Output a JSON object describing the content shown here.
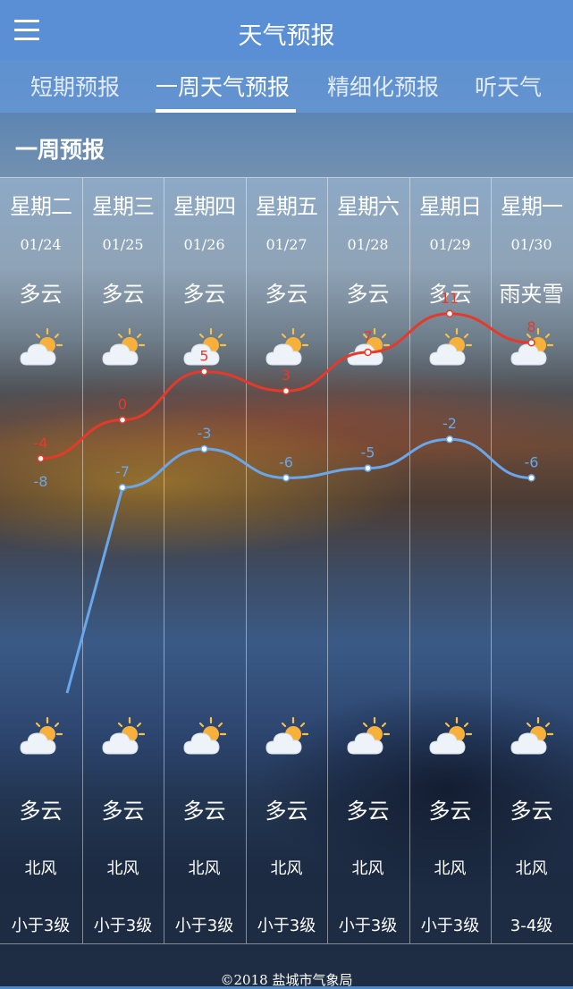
{
  "header": {
    "title": "天气预报",
    "menu_icon": "hamburger-menu-icon"
  },
  "tabs": [
    {
      "label": "短期预报",
      "active": false
    },
    {
      "label": "一周天气预报",
      "active": true
    },
    {
      "label": "精细化预报",
      "active": false
    },
    {
      "label": "听天气",
      "active": false
    }
  ],
  "section": {
    "title": "一周预报"
  },
  "days": [
    {
      "weekday": "星期二",
      "date": "01/24",
      "day_condition": "多云",
      "night_condition": "多云",
      "wind_direction": "北风",
      "wind_level": "小于3级",
      "icon": "partly-cloudy-icon"
    },
    {
      "weekday": "星期三",
      "date": "01/25",
      "day_condition": "多云",
      "night_condition": "多云",
      "wind_direction": "北风",
      "wind_level": "小于3级",
      "icon": "partly-cloudy-icon"
    },
    {
      "weekday": "星期四",
      "date": "01/26",
      "day_condition": "多云",
      "night_condition": "多云",
      "wind_direction": "北风",
      "wind_level": "小于3级",
      "icon": "partly-cloudy-icon"
    },
    {
      "weekday": "星期五",
      "date": "01/27",
      "day_condition": "多云",
      "night_condition": "多云",
      "wind_direction": "北风",
      "wind_level": "小于3级",
      "icon": "partly-cloudy-icon"
    },
    {
      "weekday": "星期六",
      "date": "01/28",
      "day_condition": "多云",
      "night_condition": "多云",
      "wind_direction": "北风",
      "wind_level": "小于3级",
      "icon": "partly-cloudy-icon"
    },
    {
      "weekday": "星期日",
      "date": "01/29",
      "day_condition": "多云",
      "night_condition": "多云",
      "wind_direction": "北风",
      "wind_level": "小于3级",
      "icon": "partly-cloudy-icon"
    },
    {
      "weekday": "星期一",
      "date": "01/30",
      "day_condition": "雨夹雪",
      "night_condition": "多云",
      "wind_direction": "北风",
      "wind_level": "3-4级",
      "icon": "partly-cloudy-icon"
    }
  ],
  "chart_data": {
    "type": "line",
    "categories": [
      "01/24",
      "01/25",
      "01/26",
      "01/27",
      "01/28",
      "01/29",
      "01/30"
    ],
    "series": [
      {
        "values": [
          -4,
          0,
          5,
          3,
          7,
          11,
          8
        ],
        "color": "#e53a2b"
      },
      {
        "values": [
          -8,
          -7,
          -3,
          -6,
          -5,
          -2,
          -6
        ],
        "color": "#6aa6ea"
      }
    ],
    "y_range": [
      -8,
      11
    ],
    "grid": false
  },
  "footer": {
    "text": "©2018 盐城市气象局"
  },
  "colors": {
    "header_bg": "#5a8fd6",
    "high_line": "#e53a2b",
    "low_line": "#6aa6ea"
  }
}
